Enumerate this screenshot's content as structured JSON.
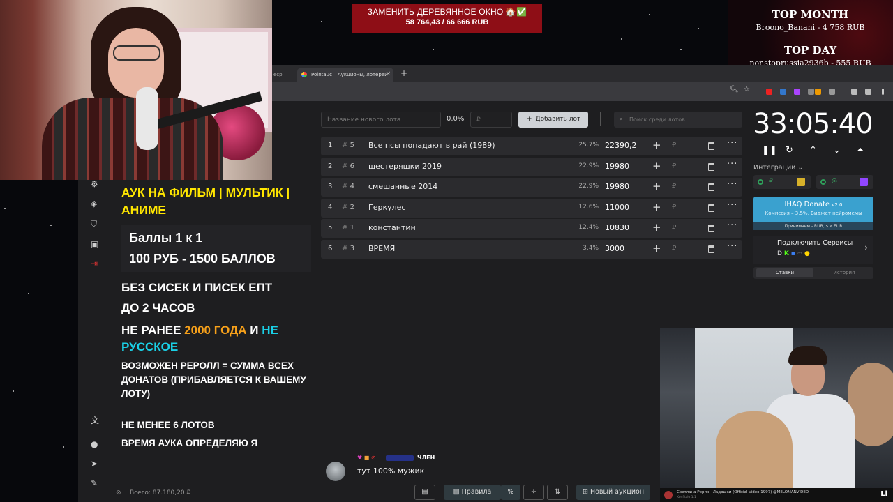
{
  "banner": {
    "goal": "ЗАМЕНИТЬ ДЕРЕВЯННОЕ ОКНО 🏠✅",
    "progress": "58 764,43 / 66 666 RUB"
  },
  "top_month": {
    "title": "TOP MONTH",
    "value": "Broono_Banani - 4 758 RUB"
  },
  "top_day": {
    "title": "TOP DAY",
    "value": "nonstoprussia2936b - 555 RUB"
  },
  "browser": {
    "tab_partial": "ecp",
    "tab_active": "Pointauc – Аукционы, лотереи",
    "close": "×",
    "new_tab": "+"
  },
  "auction": {
    "lot_placeholder": "Название нового лота",
    "percent": "0.0%",
    "amount_placeholder": "₽",
    "add_button": "Добавить лот",
    "search_placeholder": "Поиск среди лотов...",
    "currency_symbol": "₽",
    "lots": [
      {
        "num": "1",
        "id": "5",
        "name": "Все псы попадают в рай (1989)",
        "percent": "25.7%",
        "amount": "22390,2"
      },
      {
        "num": "2",
        "id": "6",
        "name": "шестеряшки 2019",
        "percent": "22.9%",
        "amount": "19980"
      },
      {
        "num": "3",
        "id": "4",
        "name": "смешанные 2014",
        "percent": "22.9%",
        "amount": "19980"
      },
      {
        "num": "4",
        "id": "2",
        "name": "Геркулес",
        "percent": "12.6%",
        "amount": "11000"
      },
      {
        "num": "5",
        "id": "1",
        "name": "константин",
        "percent": "12.4%",
        "amount": "10830"
      },
      {
        "num": "6",
        "id": "3",
        "name": "ВРЕМЯ",
        "percent": "3.4%",
        "amount": "3000"
      }
    ],
    "timer": "33:05:40",
    "integrations": "Интеграции",
    "donate_title": "IHAQ Donate",
    "donate_version": "v2.0",
    "donate_commission": "Комиссия – 3,5%, Виджет нейромемы",
    "donate_accepts": "Принимаем - RUB, $ и EUR",
    "connect_services": "Подключить Сервисы",
    "tab_bets": "Ставки",
    "tab_history": "История",
    "total": "Всего: 87.180,20 ₽",
    "toolbar": {
      "rules": "Правила",
      "new_auction": "Новый аукцион"
    }
  },
  "rules": {
    "title": "АУК НА ФИЛЬМ | МУЛЬТИК | АНИМЕ",
    "points_line1": "Баллы 1 к 1",
    "points_line2": "100 РУБ - 1500 БАЛЛОВ",
    "line_no": "БЕЗ СИСЕК И ПИСЕК ЕПТ",
    "line_hours": "ДО 2 ЧАСОВ",
    "line_year_a": "НЕ РАНЕЕ",
    "line_year_b": "2000 ГОДА",
    "line_year_c": "И",
    "line_year_d": "НЕ РУССКОЕ",
    "line_reroll": "ВОЗМОЖЕН РЕРОЛЛ = СУММА ВСЕХ ДОНАТОВ (ПРИБАВЛЯЕТСЯ К ВАШЕМУ ЛОТУ)",
    "line_lots": "НЕ МЕНЕЕ 6 ЛОТОВ",
    "line_time": "ВРЕМЯ АУКА ОПРЕДЕЛЯЮ Я"
  },
  "chat": {
    "tag": "ЧЛЕН",
    "message": "тут 100% мужик"
  },
  "video": {
    "title": "Светлана Рерих - Ладошки (Official Video 1997) @MELOMANVIDEO",
    "channel": "Konfitsio 1.1",
    "logo": "Ll"
  },
  "colors": {
    "banner_bg": "#8e0e16",
    "title_yellow": "#ffe600",
    "orange": "#f6a01a",
    "cyan": "#1ad0e6",
    "donate_blue": "#3aa1cf"
  }
}
